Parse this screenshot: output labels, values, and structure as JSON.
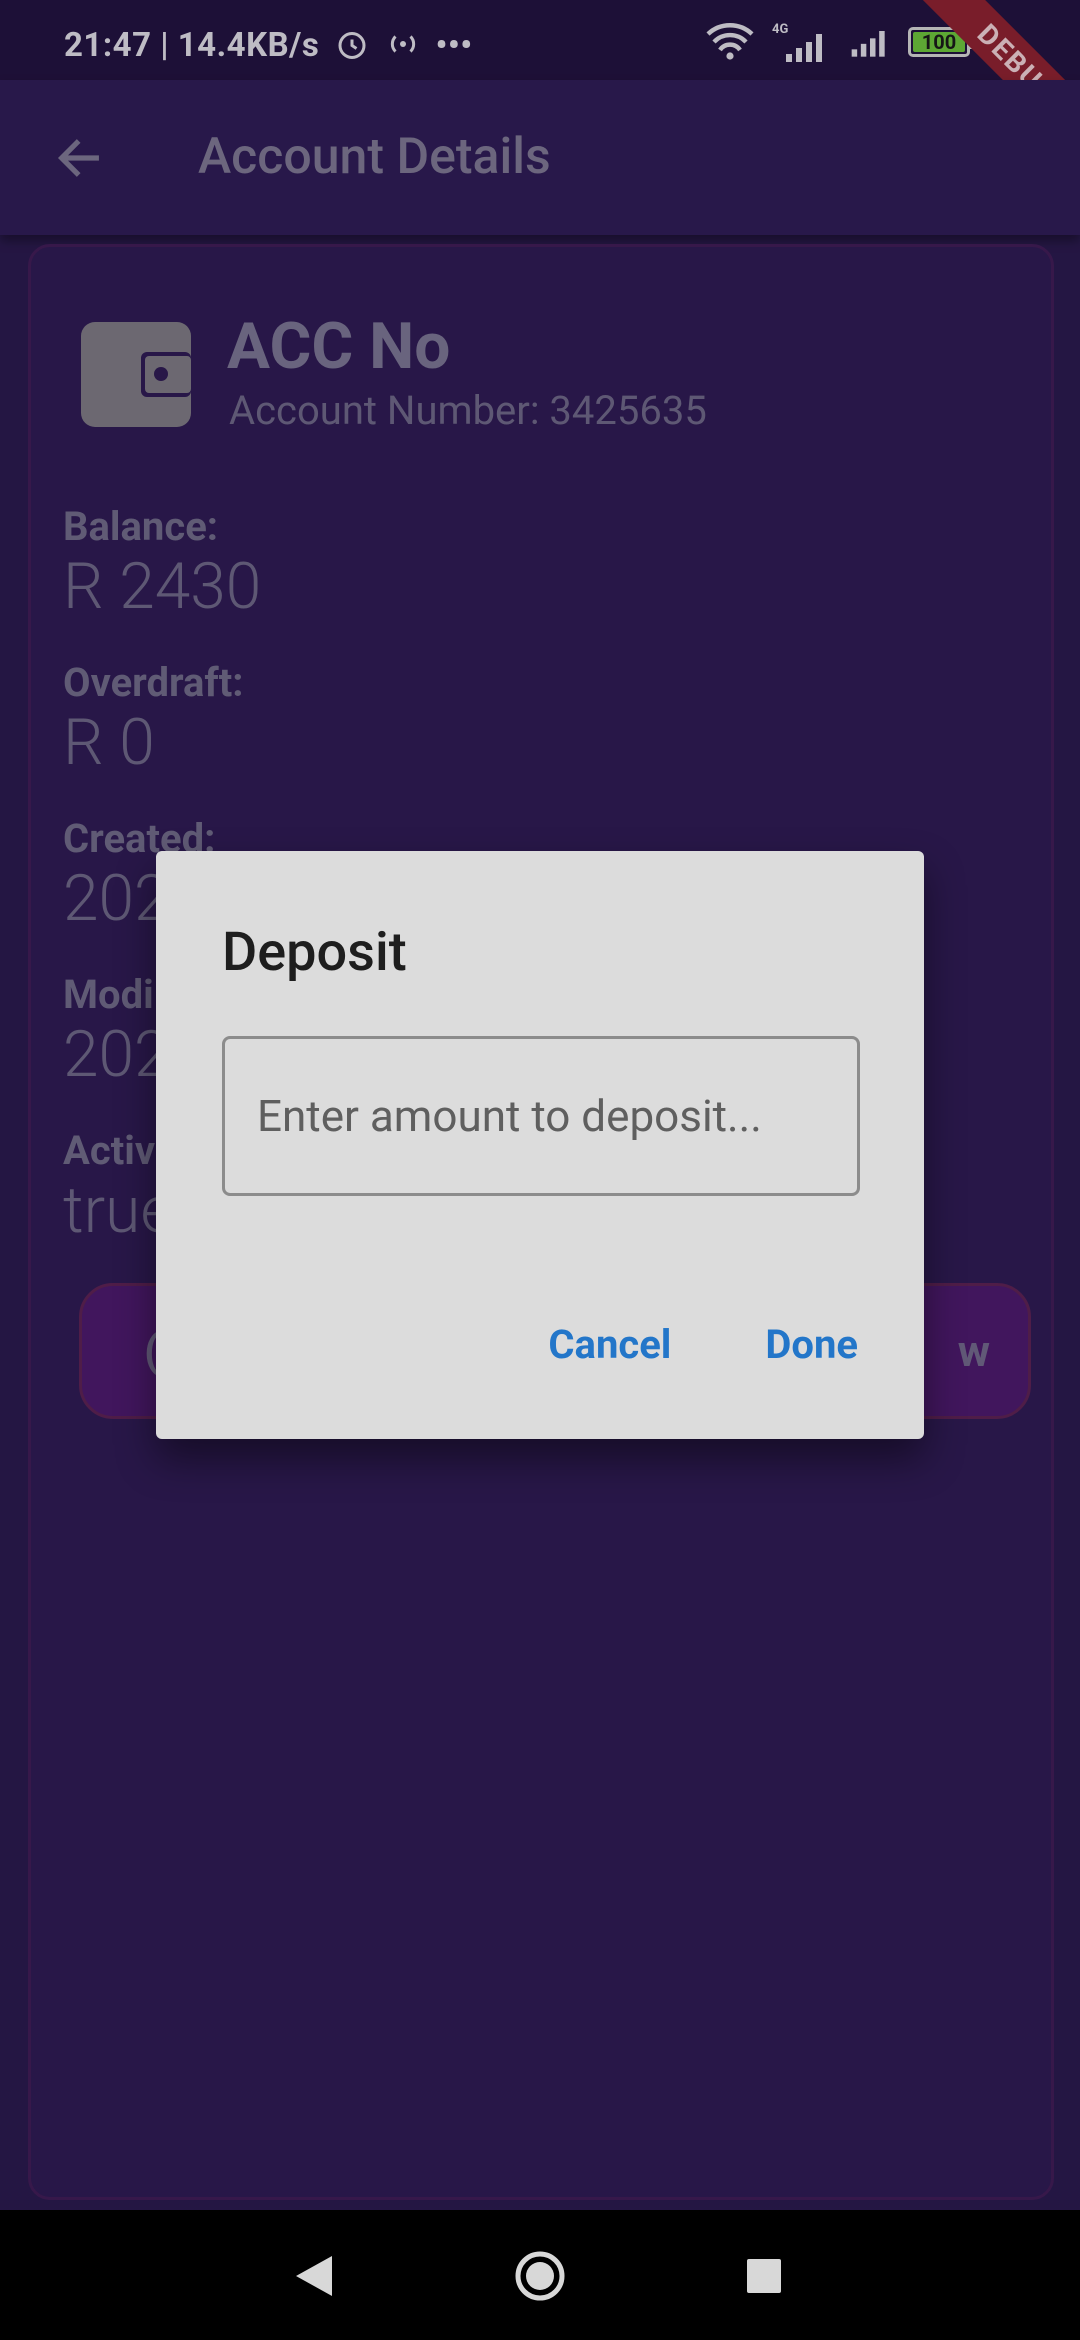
{
  "status_bar": {
    "time_speed": "21:47 | 14.4KB/s",
    "network_label": "4G",
    "battery_level": "100",
    "debug_label": "DEBUG"
  },
  "app_bar": {
    "title": "Account Details",
    "back_icon": "arrow-back-icon"
  },
  "account": {
    "icon": "wallet-icon",
    "title": "ACC No",
    "subtitle": "Account Number: 3425635",
    "fields": [
      {
        "label": "Balance:",
        "value": "R 2430"
      },
      {
        "label": "Overdraft:",
        "value": "R 0"
      },
      {
        "label": "Created:",
        "value": "202"
      },
      {
        "label": "Modi",
        "value": "202"
      },
      {
        "label": "Activ",
        "value": "true"
      }
    ],
    "buttons": {
      "left_partial": "(",
      "right_partial": "w"
    }
  },
  "dialog": {
    "title": "Deposit",
    "input_placeholder": "Enter amount to deposit...",
    "cancel_label": "Cancel",
    "done_label": "Done"
  },
  "nav_bar": {
    "icons": [
      "nav-back-icon",
      "nav-home-icon",
      "nav-recents-icon"
    ]
  },
  "colors": {
    "background": "#2a1a4d",
    "dialog_bg": "#dcdcdc",
    "accent": "#2376c9",
    "action_button": "#4a1a6a"
  }
}
